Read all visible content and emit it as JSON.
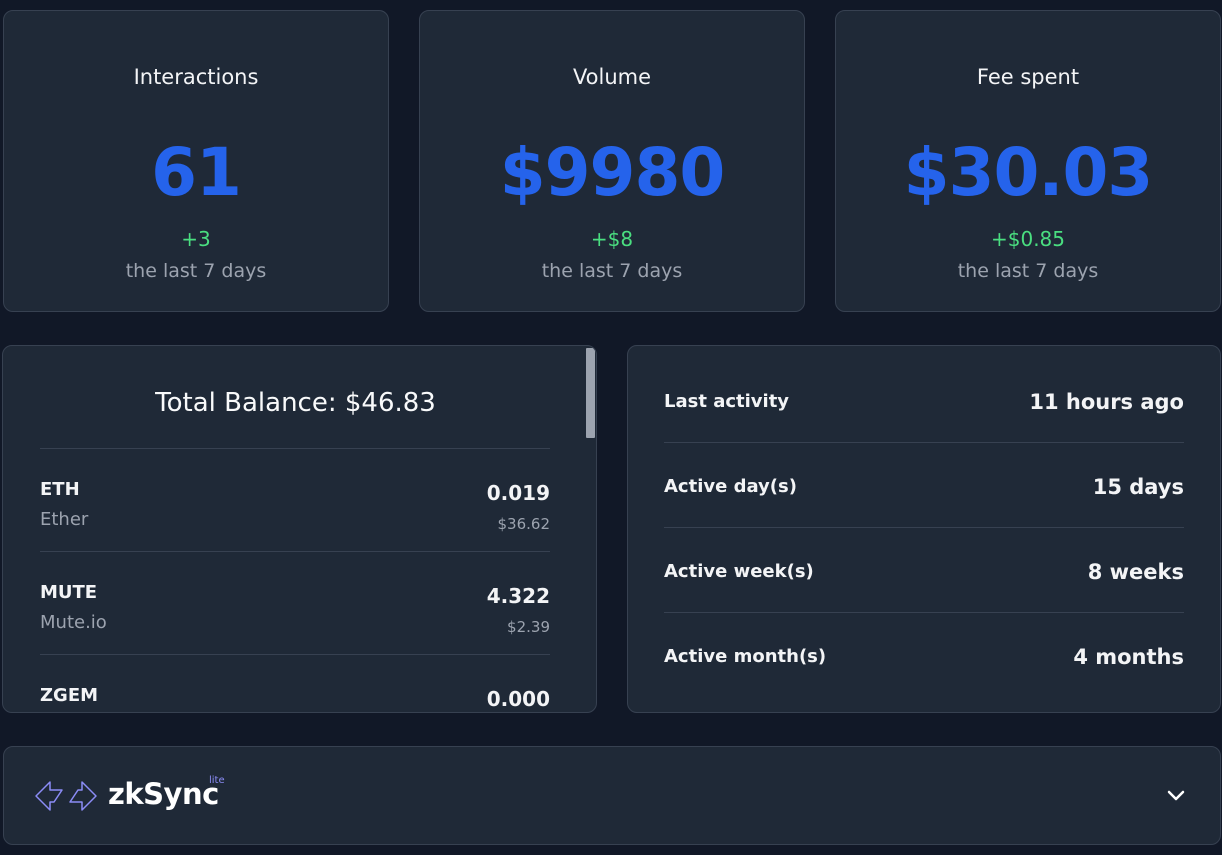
{
  "stats": [
    {
      "title": "Interactions",
      "value": "61",
      "change": "+3",
      "period": "the last 7 days"
    },
    {
      "title": "Volume",
      "value": "$9980",
      "change": "+$8",
      "period": "the last 7 days"
    },
    {
      "title": "Fee spent",
      "value": "$30.03",
      "change": "+$0.85",
      "period": "the last 7 days"
    }
  ],
  "balance": {
    "title": "Total Balance: $46.83",
    "tokens": [
      {
        "symbol": "ETH",
        "name": "Ether",
        "amount": "0.019",
        "usd": "$36.62"
      },
      {
        "symbol": "MUTE",
        "name": "Mute.io",
        "amount": "4.322",
        "usd": "$2.39"
      },
      {
        "symbol": "ZGEM",
        "name": "",
        "amount": "0.000",
        "usd": ""
      }
    ]
  },
  "activity": [
    {
      "label": "Last activity",
      "value": "11 hours ago"
    },
    {
      "label": "Active day(s)",
      "value": "15 days"
    },
    {
      "label": "Active week(s)",
      "value": "8 weeks"
    },
    {
      "label": "Active month(s)",
      "value": "4 months"
    }
  ],
  "footer": {
    "brand": "zkSync",
    "brand_sup": "lite",
    "logo_icon": "zksync-arrows-icon",
    "toggle_icon": "chevron-down-icon"
  },
  "colors": {
    "background": "#111827",
    "card": "#1f2937",
    "accent": "#2563eb",
    "positive": "#4ade80",
    "muted": "#9ca3af",
    "brand_purple": "#8b8cf6"
  }
}
